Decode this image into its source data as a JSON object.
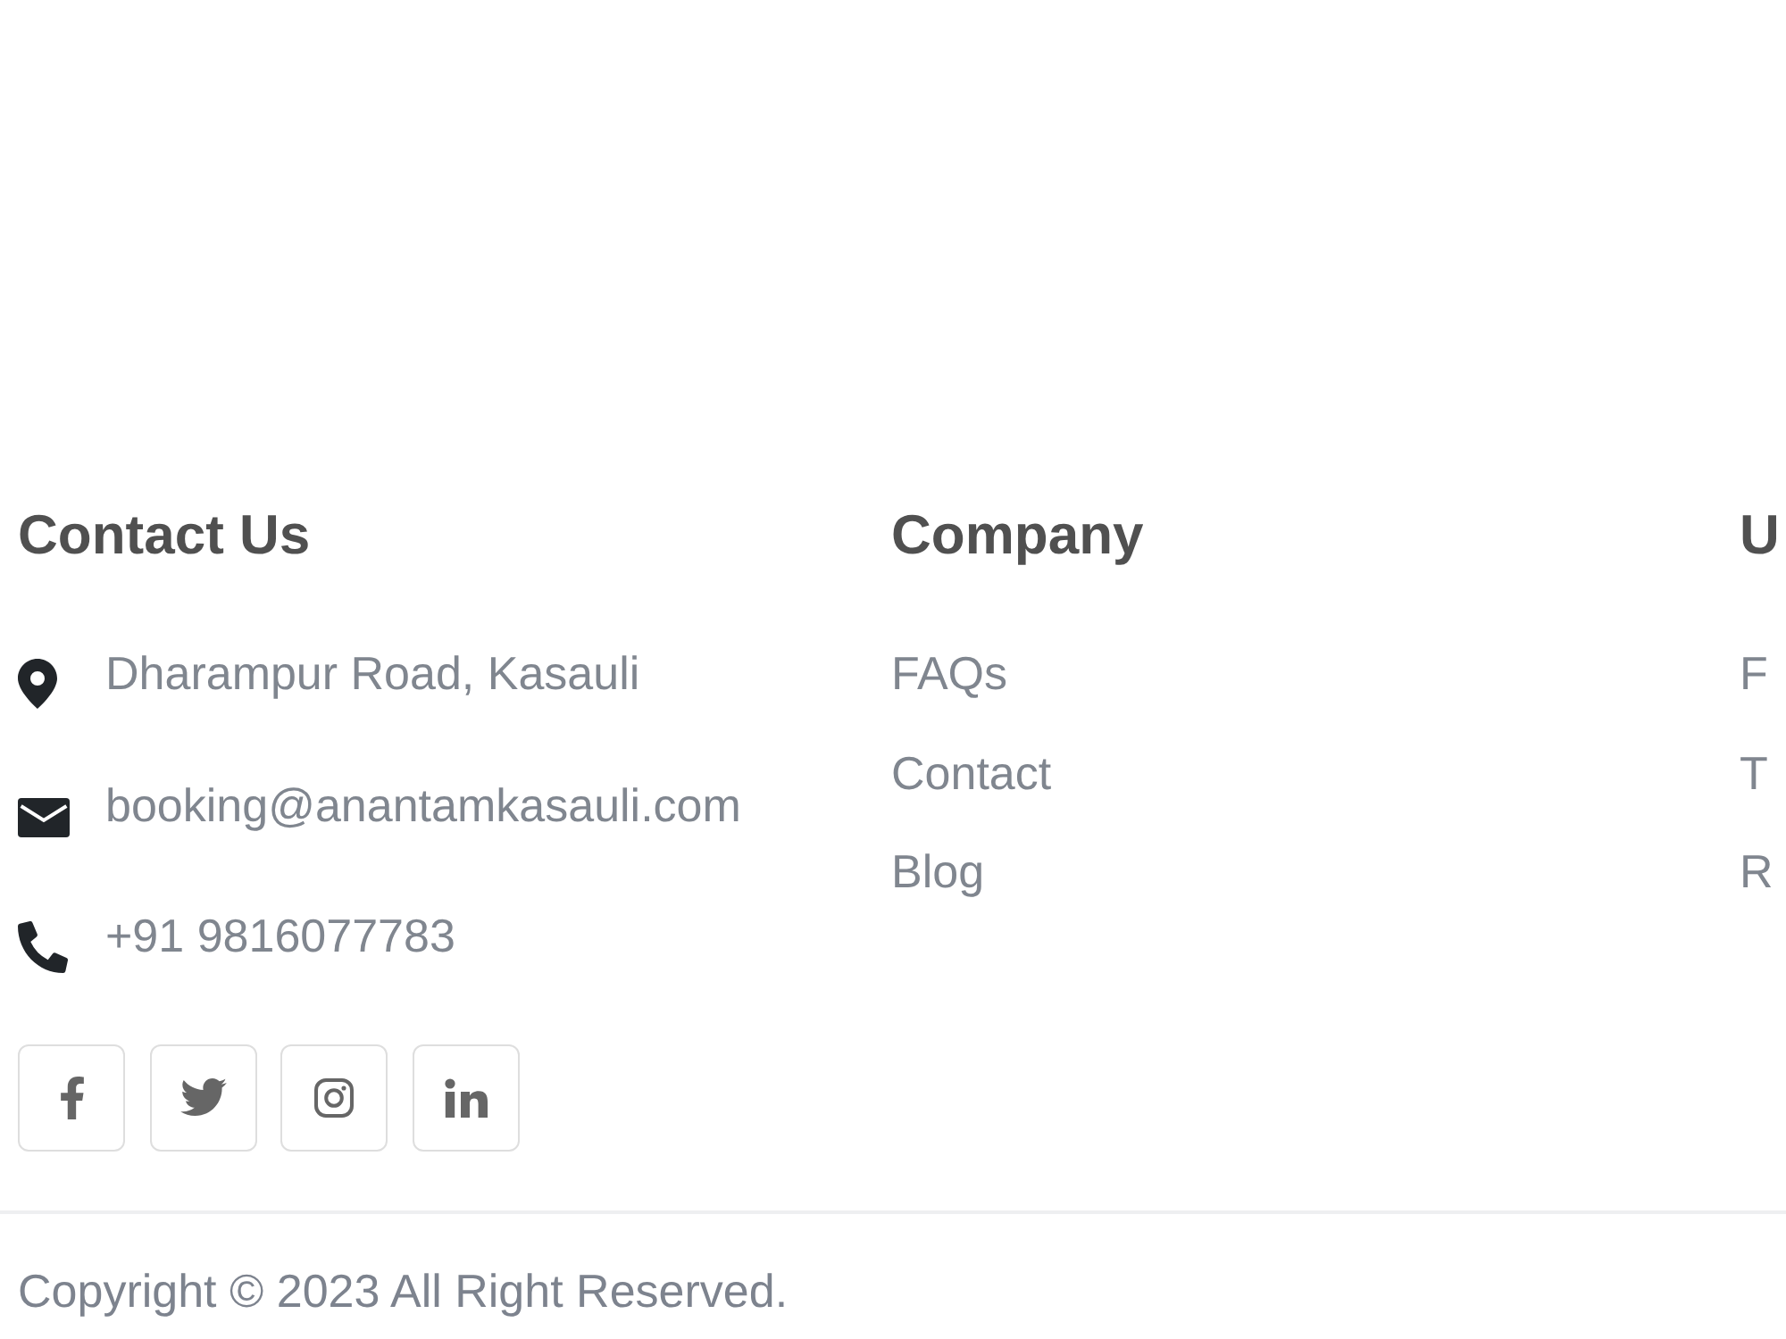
{
  "contact": {
    "heading": "Contact Us",
    "items": [
      {
        "kind": "address",
        "text": "Dharampur Road, Kasauli"
      },
      {
        "kind": "email",
        "text": "booking@anantamkasauli.com"
      },
      {
        "kind": "phone",
        "text": "+91 9816077783"
      }
    ],
    "social_links": [
      {
        "kind": "facebook"
      },
      {
        "kind": "twitter"
      },
      {
        "kind": "instagram"
      },
      {
        "kind": "linkedin"
      }
    ]
  },
  "company": {
    "heading": "Company",
    "links": [
      "FAQs",
      "Contact",
      "Blog"
    ]
  },
  "column_3": {
    "heading": "U",
    "links": [
      "F",
      "T",
      "R"
    ]
  },
  "copyright": "Copyright © 2023 All Right Reserved."
}
